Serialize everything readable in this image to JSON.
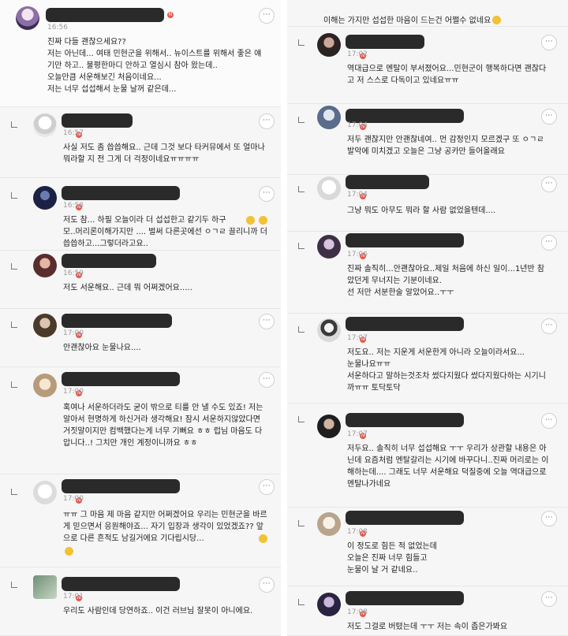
{
  "accent_colors": {
    "new_badge": "#e8574b",
    "name_redaction": "#2a2a2a"
  },
  "left_comments": [
    {
      "time": "16:56",
      "text": "진짜 다들 괜찮으세요??\n저는 아닌데... 여태 민현군을 위해서.. 뉴이스트를 위해서 좋은 얘기만 하고.. 불평한마디 안하고 열심시 참아 왔는데..\n오늘만큼 서운해보긴 처음이네요...\n저는 너무 섭섭해서 눈물 날꺼 같은데..."
    },
    {
      "time": "16:57",
      "text": "사실 저도 좀 씁씁해요.. 근데 그것 보다 타커뮤에서 또 얼마나 뭐라할 지 전 그게 더 걱정이네요ㅠㅠㅠㅠ"
    },
    {
      "time": "16:58",
      "text": "저도 참... 하필 오늘이라 더 섭섭한고 같기두 하구\n모..머리론이해가지만 .... 벌써 다른곳에선 ㅇㄱㄹ 끌리니까 더씁씁하고...그렇더라고요.."
    },
    {
      "time": "16:59",
      "text": "저도 서운해요.. 근데 뭐 어쩌겠어요....."
    },
    {
      "time": "17:00",
      "text": "안괜찮아요 눈물나요...."
    },
    {
      "time": "17:00",
      "text": "혹여나 서운하더라도 굳이 밖으로 티를 안 낼 수도 있죠! 저는 알아서 현명하게 하신거라 생각해요! 잠시 서운하지않았다면 거짓말이지만 컴백했다는게 너무 기뻐요 ㅎㅎ 럽님 마음도 다 압니다..! 그치만 개인 계정이니까요 ㅎㅎ"
    },
    {
      "time": "17:00",
      "text": "ㅠㅠ 그 마음 제 마음 같지만 어쩌겠어요 우리는 민현군을 바르게 믿으면서 응원해야죠... 자기 입장과 생각이 있었겠죠?? 앞으로 다른 흔적도 남길거에요 기다립시당..."
    },
    {
      "time": "17:01",
      "text": "우리도 사람인데 당연하죠.. 이건 러브님 잘못이 아니에요."
    }
  ],
  "right_comments": [
    {
      "time": "",
      "text": "이해는 가지만 섭섭한 마음이 드는건 어쩔수 없네요"
    },
    {
      "time": "17:02",
      "text": "역대급으로 멘탈이 부서졌어요...민현군이 행복하다면 괜찮다고 저 스스로 다독이고 있네요ㅠㅠ"
    },
    {
      "time": "17:04",
      "text": "저두 괜찮지만 안괜찮네여.. 먼 감정인지 모르겠구 또 ㅇㄱㄹ 발악에 미치겠고 오늘은 그냥 공카만 들어올래요"
    },
    {
      "time": "17:04",
      "text": "그냥 뭐도 아무도 뭐라 할 사람 없었을텐데...."
    },
    {
      "time": "17:06",
      "text": "진짜 솔직히...안괜찮아요..제일 처음에 하신 일이...1년반 참았던게 무너지는 기분이네요.\n선 저만 서분한술 알았어요..ㅜㅜ"
    },
    {
      "time": "17:07",
      "text": "저도요.. 저는 지운게 서운한게 아니라 오늘이라서요...\n눈물나요ㅠㅠ\n서운하다고 말하는것조차 썼다지웠다 썼다지웠다하는 시기니까ㅠㅠ 토닥토닥"
    },
    {
      "time": "17:07",
      "text": "저두요.. 솔직히 너무 섭섭해요 ㅜㅜ 우리가 상관할 내용은 아닌데 요즘처럼 멘탈갈리는 시기에 바꾸다니..진짜 머리로는 이해하는데.... 그래도 너무 서운해요 덕질중에 오늘 역대급으로 멘탈나가네요"
    },
    {
      "time": "17:08",
      "text": "이 정도로 힘든 적 없었는데\n오늘은 진짜 너무 힘들고\n눈물이 날 거 같네요.."
    },
    {
      "time": "17:08",
      "text": "저도 그걸로 버텼는데 ㅜㅜ 저는 속이 좁은가봐요"
    }
  ]
}
